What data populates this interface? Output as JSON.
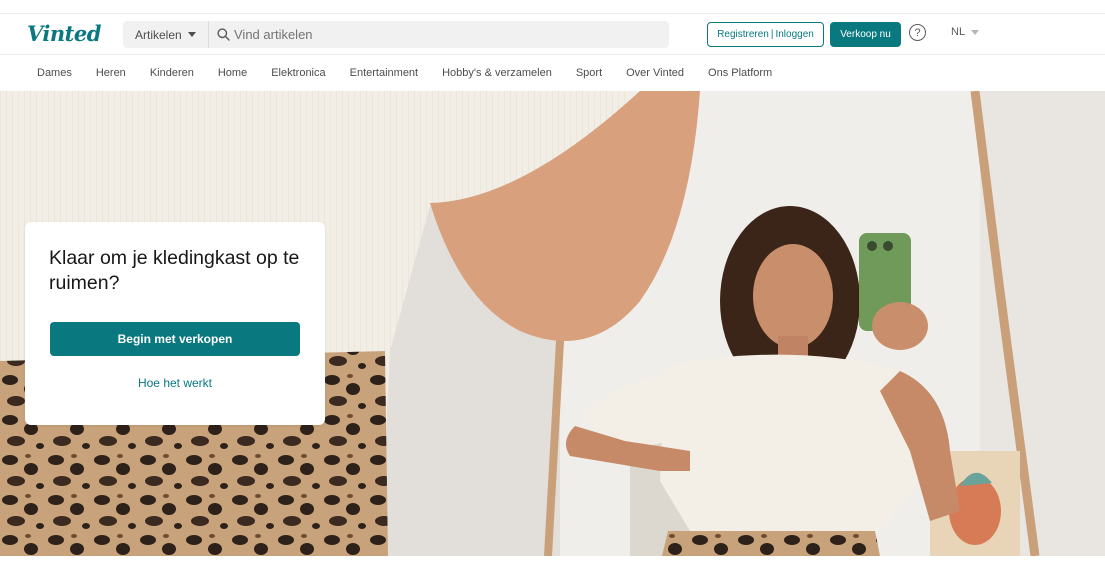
{
  "header": {
    "logo": "Vinted",
    "search": {
      "category": "Artikelen",
      "placeholder": "Vind artikelen"
    },
    "auth": {
      "register": "Registreren",
      "separator": "|",
      "login": "Inloggen"
    },
    "sell_button": "Verkoop nu",
    "help_glyph": "?",
    "language": "NL"
  },
  "categories": [
    "Dames",
    "Heren",
    "Kinderen",
    "Home",
    "Elektronica",
    "Entertainment",
    "Hobby's & verzamelen",
    "Sport",
    "Over Vinted",
    "Ons Platform"
  ],
  "hero": {
    "title": "Klaar om je kledingkast op te ruimen?",
    "primary_cta": "Begin met verkopen",
    "secondary_cta": "Hoe het werkt"
  },
  "colors": {
    "brand": "#09787f",
    "text": "#171717",
    "muted": "#4d4d4d"
  },
  "icons": [
    "search-icon",
    "chevron-down-icon",
    "help-icon"
  ]
}
